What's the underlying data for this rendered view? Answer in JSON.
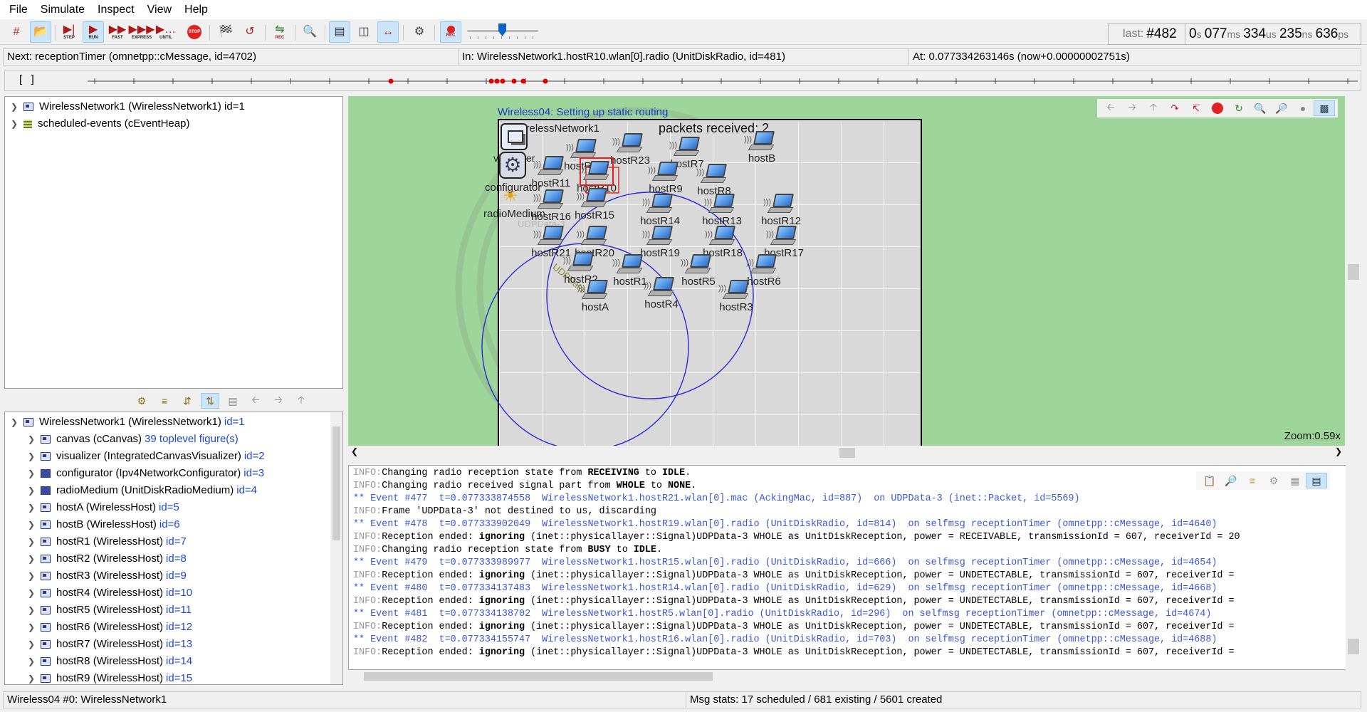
{
  "menu": [
    "File",
    "Simulate",
    "Inspect",
    "View",
    "Help"
  ],
  "toolbar": {
    "step_caption": "STEP",
    "run_caption": "RUN",
    "fast_caption": "FAST",
    "express_caption": "EXPRESS",
    "until_caption": "UNTIL",
    "stop_caption": "STOP",
    "rec_caption": "REC",
    "last_event_label": "last:",
    "last_event_value": "#482",
    "sim_time": {
      "s": "0",
      "ms": "077",
      "us": "334",
      "ns": "235",
      "ps": "636"
    },
    "unit_s": "s",
    "unit_ms": "ms",
    "unit_us": "us",
    "unit_ns": "ns",
    "unit_ps": "ps"
  },
  "status": {
    "next": "Next: receptionTimer (omnetpp::cMessage, id=4702)",
    "in": "In: WirelessNetwork1.hostR10.wlan[0].radio (UnitDiskRadio, id=481)",
    "at": "At: 0.077334263146s (now+0.00000002751s)"
  },
  "timeline": {
    "brackets": "[   ]"
  },
  "object_tree": [
    {
      "label": "WirelessNetwork1 (WirelessNetwork1) id=1"
    },
    {
      "label": "scheduled-events (cEventHeap)"
    }
  ],
  "module_tree": {
    "root": {
      "label": "WirelessNetwork1 (WirelessNetwork1)",
      "id": "id=1"
    },
    "children": [
      {
        "label": "canvas (cCanvas)",
        "id": "39 toplevel figure(s)"
      },
      {
        "label": "visualizer (IntegratedCanvasVisualizer)",
        "id": "id=2"
      },
      {
        "label": "configurator (Ipv4NetworkConfigurator)",
        "id": "id=3"
      },
      {
        "label": "radioMedium (UnitDiskRadioMedium)",
        "id": "id=4"
      },
      {
        "label": "hostA (WirelessHost)",
        "id": "id=5"
      },
      {
        "label": "hostB (WirelessHost)",
        "id": "id=6"
      },
      {
        "label": "hostR1 (WirelessHost)",
        "id": "id=7"
      },
      {
        "label": "hostR2 (WirelessHost)",
        "id": "id=8"
      },
      {
        "label": "hostR3 (WirelessHost)",
        "id": "id=9"
      },
      {
        "label": "hostR4 (WirelessHost)",
        "id": "id=10"
      },
      {
        "label": "hostR5 (WirelessHost)",
        "id": "id=11"
      },
      {
        "label": "hostR6 (WirelessHost)",
        "id": "id=12"
      },
      {
        "label": "hostR7 (WirelessHost)",
        "id": "id=13"
      },
      {
        "label": "hostR8 (WirelessHost)",
        "id": "id=14"
      },
      {
        "label": "hostR9 (WirelessHost)",
        "id": "id=15"
      }
    ]
  },
  "canvas": {
    "scenario_title": "Wireless04: Setting up static routing",
    "network_name": "WirelessNetwork1",
    "packets_received": "packets received: 2",
    "zoom": "Zoom:0.59x",
    "visualizer_label": "visualizer",
    "configurator_label": "configurator",
    "radio_medium_label": "radioMedium",
    "packet_label_1": "UDPData-3",
    "packet_label_2": "UDPData-3",
    "hosts": [
      "hostR22",
      "hostR23",
      "hostR7",
      "hostB",
      "hostR11",
      "hostR10",
      "hostR9",
      "hostR8",
      "hostR16",
      "hostR15",
      "hostR14",
      "hostR13",
      "hostR12",
      "hostR21",
      "hostR20",
      "hostR19",
      "hostR18",
      "hostR17",
      "hostR2",
      "hostR1",
      "hostR5",
      "hostR6",
      "hostA",
      "hostR4",
      "hostR3"
    ]
  },
  "log": [
    {
      "type": "info",
      "prefix": "INFO:",
      "parts": [
        "Changing radio reception state from ",
        "RECEIVING",
        " to ",
        "IDLE",
        "."
      ]
    },
    {
      "type": "info",
      "prefix": "INFO:",
      "parts": [
        "Changing radio received signal part from ",
        "WHOLE",
        " to ",
        "NONE",
        "."
      ]
    },
    {
      "type": "event",
      "text": "** Event #477  t=0.077333874558  WirelessNetwork1.hostR21.wlan[0].mac (AckingMac, id=887)  on UDPData-3 (inet::Packet, id=5569)"
    },
    {
      "type": "info",
      "prefix": "INFO:",
      "parts": [
        "Frame 'UDPData-3' not destined to us, discarding"
      ]
    },
    {
      "type": "event",
      "text": "** Event #478  t=0.077333902049  WirelessNetwork1.hostR19.wlan[0].radio (UnitDiskRadio, id=814)  on selfmsg receptionTimer (omnetpp::cMessage, id=4640)"
    },
    {
      "type": "info",
      "prefix": "INFO:",
      "parts": [
        "Reception ended: ",
        "ignoring",
        " (inet::physicallayer::Signal)UDPData-3 WHOLE as UnitDiskReception, power = RECEIVABLE, transmissionId = 607, receiverId = 20"
      ]
    },
    {
      "type": "info",
      "prefix": "INFO:",
      "parts": [
        "Changing radio reception state from ",
        "BUSY",
        " to ",
        "IDLE",
        "."
      ]
    },
    {
      "type": "event",
      "text": "** Event #479  t=0.077333989977  WirelessNetwork1.hostR15.wlan[0].radio (UnitDiskRadio, id=666)  on selfmsg receptionTimer (omnetpp::cMessage, id=4654)"
    },
    {
      "type": "info",
      "prefix": "INFO:",
      "parts": [
        "Reception ended: ",
        "ignoring",
        " (inet::physicallayer::Signal)UDPData-3 WHOLE as UnitDiskReception, power = UNDETECTABLE, transmissionId = 607, receiverId ="
      ]
    },
    {
      "type": "event",
      "text": "** Event #480  t=0.077334137483  WirelessNetwork1.hostR14.wlan[0].radio (UnitDiskRadio, id=629)  on selfmsg receptionTimer (omnetpp::cMessage, id=4668)"
    },
    {
      "type": "info",
      "prefix": "INFO:",
      "parts": [
        "Reception ended: ",
        "ignoring",
        " (inet::physicallayer::Signal)UDPData-3 WHOLE as UnitDiskReception, power = UNDETECTABLE, transmissionId = 607, receiverId ="
      ]
    },
    {
      "type": "event",
      "text": "** Event #481  t=0.077334138702  WirelessNetwork1.hostR5.wlan[0].radio (UnitDiskRadio, id=296)  on selfmsg receptionTimer (omnetpp::cMessage, id=4674)"
    },
    {
      "type": "info",
      "prefix": "INFO:",
      "parts": [
        "Reception ended: ",
        "ignoring",
        " (inet::physicallayer::Signal)UDPData-3 WHOLE as UnitDiskReception, power = UNDETECTABLE, transmissionId = 607, receiverId ="
      ]
    },
    {
      "type": "event",
      "text": "** Event #482  t=0.077334155747  WirelessNetwork1.hostR16.wlan[0].radio (UnitDiskRadio, id=703)  on selfmsg receptionTimer (omnetpp::cMessage, id=4688)"
    },
    {
      "type": "info",
      "prefix": "INFO:",
      "parts": [
        "Reception ended: ",
        "ignoring",
        " (inet::physicallayer::Signal)UDPData-3 WHOLE as UnitDiskReception, power = UNDETECTABLE, transmissionId = 607, receiverId ="
      ]
    }
  ],
  "bottom": {
    "left": "Wireless04 #0: WirelessNetwork1",
    "right": "Msg stats: 17 scheduled / 681 existing / 5601 created"
  },
  "colors": {
    "canvas_bg": "#9ed59a",
    "id_blue": "#1a47d8",
    "event_blue": "#3a56d8",
    "accent": "#cce4f7"
  }
}
